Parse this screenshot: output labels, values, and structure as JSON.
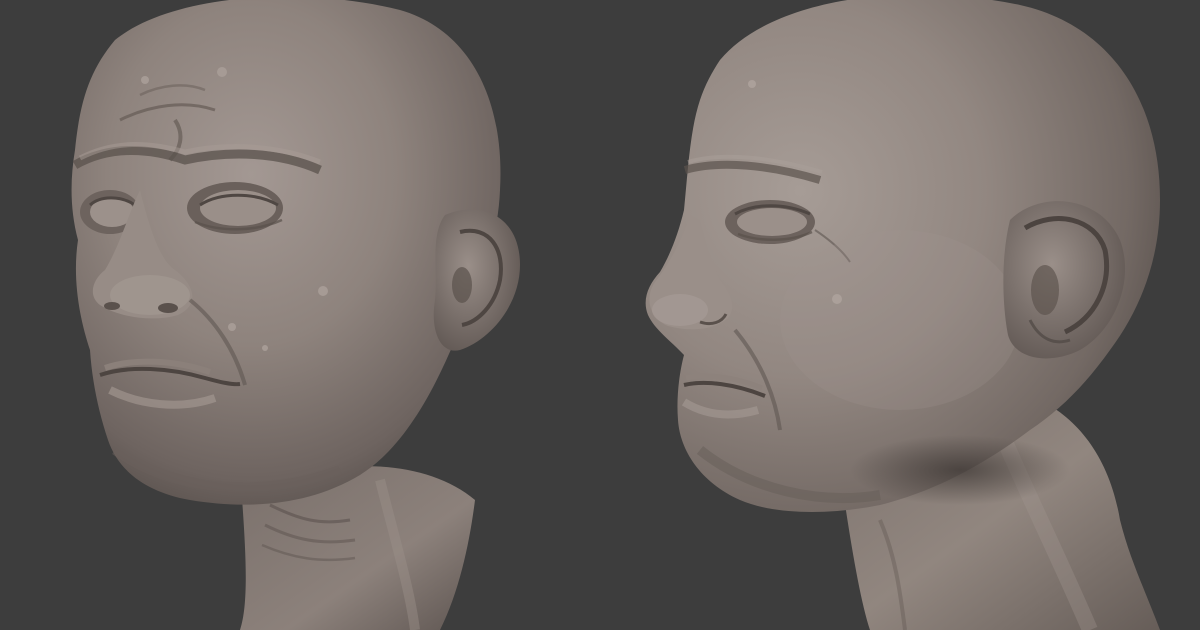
{
  "scene": {
    "background_color": "#3d3d3d",
    "material_color": "#8a7f79",
    "views": [
      {
        "id": "view-three-quarter",
        "description_icon": "sculpted-head-three-quarter"
      },
      {
        "id": "view-profile",
        "description_icon": "sculpted-head-profile"
      }
    ]
  }
}
